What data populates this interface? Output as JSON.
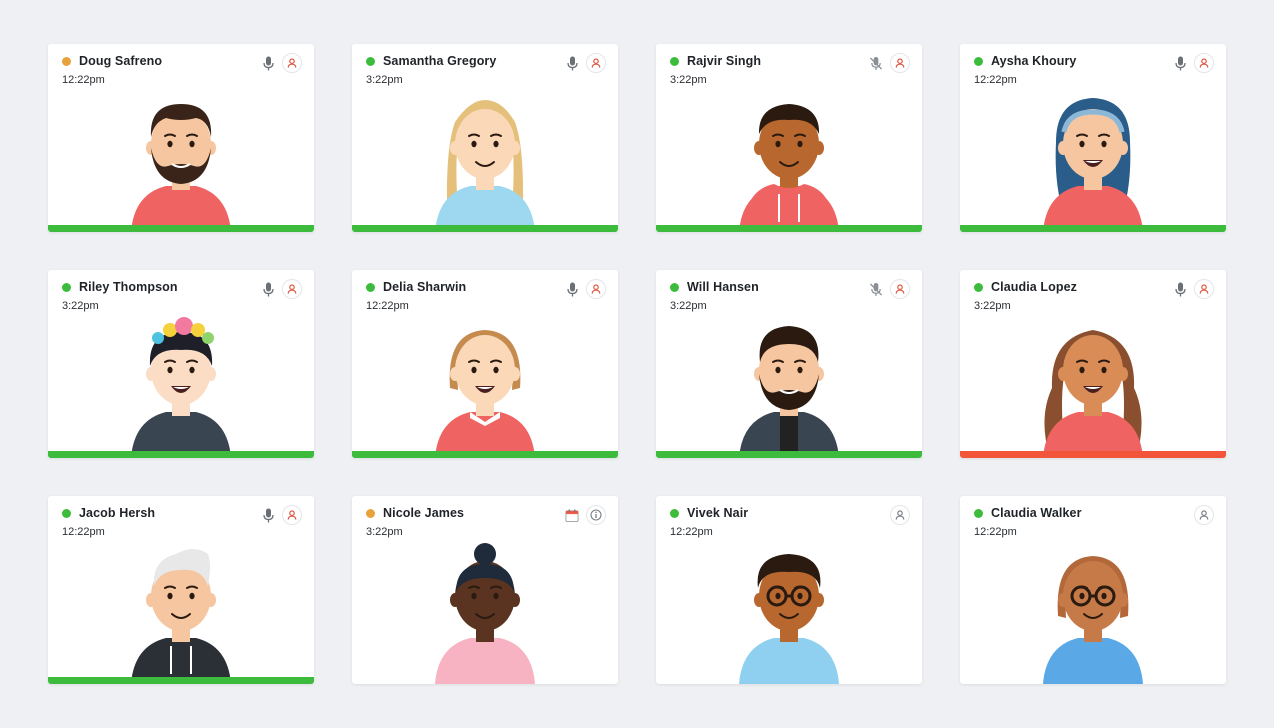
{
  "participants": [
    {
      "name": "Doug Safreno",
      "time": "12:22pm",
      "status_color": "#e8a23c",
      "mic": "on",
      "action": "person",
      "bar": "#3dbb3d",
      "avatar": "beard-man",
      "skin": "#f5c6a0",
      "hair": "#3a2419",
      "shirt": "#f06363"
    },
    {
      "name": "Samantha Gregory",
      "time": "3:22pm",
      "status_color": "#3dbb3d",
      "mic": "on",
      "action": "person",
      "bar": "#3dbb3d",
      "avatar": "long-blonde",
      "skin": "#fad8b8",
      "hair": "#e5c07b",
      "shirt": "#9ed8f0"
    },
    {
      "name": "Rajvir Singh",
      "time": "3:22pm",
      "status_color": "#3dbb3d",
      "mic": "muted",
      "action": "person",
      "bar": "#3dbb3d",
      "avatar": "hoodie-wink",
      "skin": "#b8682e",
      "hair": "#2a1a10",
      "shirt": "#f06363"
    },
    {
      "name": "Aysha Khoury",
      "time": "12:22pm",
      "status_color": "#3dbb3d",
      "mic": "on",
      "action": "person",
      "bar": "#3dbb3d",
      "avatar": "hijab",
      "skin": "#f5c6a0",
      "hair": "#2a5d8a",
      "shirt": "#f06363"
    },
    {
      "name": "Riley Thompson",
      "time": "3:22pm",
      "status_color": "#3dbb3d",
      "mic": "on",
      "action": "person",
      "bar": "#3dbb3d",
      "avatar": "flower-crown",
      "skin": "#fbdcc4",
      "hair": "#1f1f2a",
      "shirt": "#3a4552"
    },
    {
      "name": "Delia Sharwin",
      "time": "12:22pm",
      "status_color": "#3dbb3d",
      "mic": "on",
      "action": "person",
      "bar": "#3dbb3d",
      "avatar": "bob",
      "skin": "#fad8b8",
      "hair": "#c58a4e",
      "shirt": "#f06363"
    },
    {
      "name": "Will Hansen",
      "time": "3:22pm",
      "status_color": "#3dbb3d",
      "mic": "muted",
      "action": "person",
      "bar": "#3dbb3d",
      "avatar": "beard-jacket",
      "skin": "#f5c6a0",
      "hair": "#2a1a10",
      "shirt": "#3a4552"
    },
    {
      "name": "Claudia Lopez",
      "time": "3:22pm",
      "status_color": "#3dbb3d",
      "mic": "on",
      "action": "person",
      "bar": "#f2553a",
      "avatar": "wavy",
      "skin": "#d98c55",
      "hair": "#8a4f2e",
      "shirt": "#f06363"
    },
    {
      "name": "Jacob Hersh",
      "time": "12:22pm",
      "status_color": "#3dbb3d",
      "mic": "on",
      "action": "person",
      "bar": "#3dbb3d",
      "avatar": "white-quiff",
      "skin": "#f5c6a0",
      "hair": "#e8e8e8",
      "shirt": "#2b2f36"
    },
    {
      "name": "Nicole James",
      "time": "3:22pm",
      "status_color": "#e8a23c",
      "mic": "calendar",
      "action": "info",
      "bar": "",
      "avatar": "bun",
      "skin": "#5a3420",
      "hair": "#1f2a3a",
      "shirt": "#f7b3c2"
    },
    {
      "name": "Vivek Nair",
      "time": "12:22pm",
      "status_color": "#3dbb3d",
      "mic": "none",
      "action": "person-grey",
      "bar": "",
      "avatar": "glasses-curly",
      "skin": "#b8682e",
      "hair": "#2a1a10",
      "shirt": "#8fd0f0"
    },
    {
      "name": "Claudia Walker",
      "time": "12:22pm",
      "status_color": "#3dbb3d",
      "mic": "none",
      "action": "person-grey",
      "bar": "",
      "avatar": "glasses-bob",
      "skin": "#c57a48",
      "hair": "#b3683a",
      "shirt": "#5aa9e6"
    }
  ]
}
